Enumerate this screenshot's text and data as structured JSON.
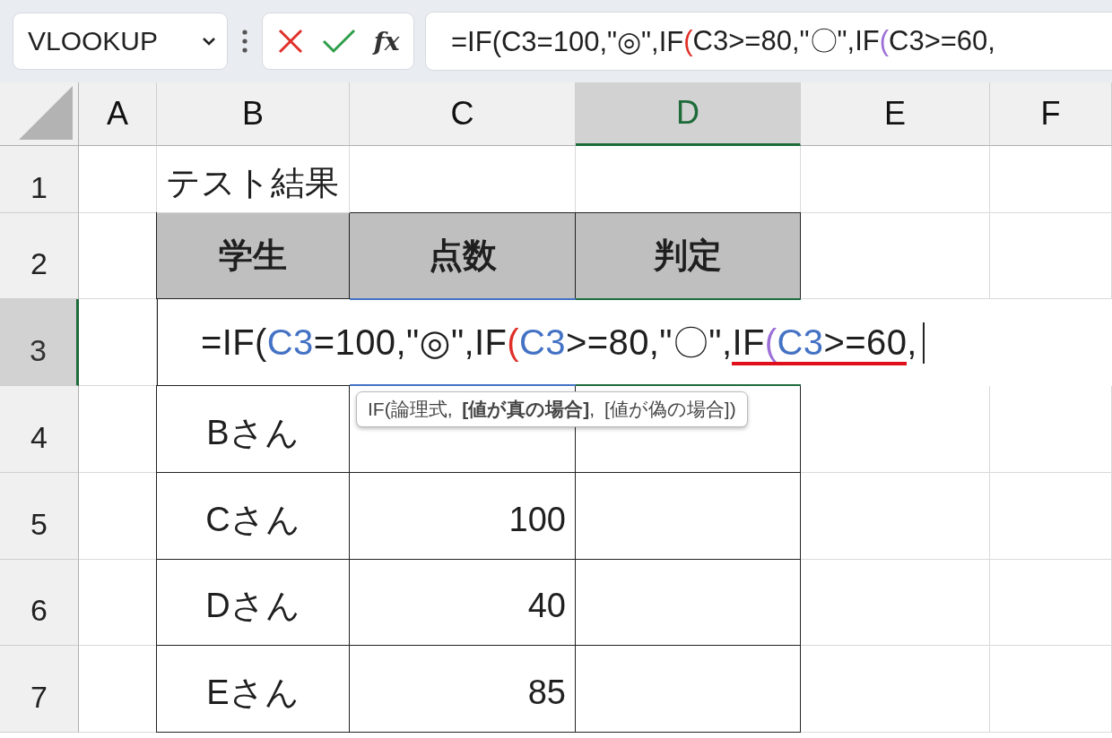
{
  "name_box": {
    "value": "VLOOKUP"
  },
  "function_button": {
    "label": "fx"
  },
  "formula_bar": {
    "segments": [
      {
        "text": "=IF(C3=100,\"◎\",IF",
        "color": "#1f1f1f"
      },
      {
        "text": "(",
        "color": "#e0302a"
      },
      {
        "text": "C3>=80,\"〇\",IF",
        "color": "#1f1f1f"
      },
      {
        "text": "(",
        "color": "#9b6fd6"
      },
      {
        "text": "C3>=60,",
        "color": "#1f1f1f"
      }
    ]
  },
  "columns": [
    {
      "label": "A",
      "selected": false
    },
    {
      "label": "B",
      "selected": false
    },
    {
      "label": "C",
      "selected": false
    },
    {
      "label": "D",
      "selected": true
    },
    {
      "label": "E",
      "selected": false
    },
    {
      "label": "F",
      "selected": false
    }
  ],
  "row_headers": [
    {
      "label": "1",
      "selected": false
    },
    {
      "label": "2",
      "selected": false
    },
    {
      "label": "3",
      "selected": true
    },
    {
      "label": "4",
      "selected": false
    },
    {
      "label": "5",
      "selected": false
    },
    {
      "label": "6",
      "selected": false
    },
    {
      "label": "7",
      "selected": false
    }
  ],
  "title": "テスト結果",
  "table": {
    "columns": [
      "学生",
      "点数",
      "判定"
    ],
    "rows": [
      {
        "student": "Bさん"
      },
      {
        "student": "Cさん",
        "score": "100"
      },
      {
        "student": "Dさん",
        "score": "40"
      },
      {
        "student": "Eさん",
        "score": "85"
      }
    ]
  },
  "editing_cell": {
    "segments": [
      {
        "text": "=IF(",
        "color": "#1f1f1f",
        "underlined": false
      },
      {
        "text": "C3",
        "color": "#4472c4",
        "underlined": false
      },
      {
        "text": "=100,\"◎\",IF",
        "color": "#1f1f1f",
        "underlined": false
      },
      {
        "text": "(",
        "color": "#e0302a",
        "underlined": false
      },
      {
        "text": "C3",
        "color": "#4472c4",
        "underlined": false
      },
      {
        "text": ">=80,\"〇\",",
        "color": "#1f1f1f",
        "underlined": false
      },
      {
        "text": "IF",
        "color": "#1f1f1f",
        "underlined": true
      },
      {
        "text": "(",
        "color": "#9b6fd6",
        "underlined": true
      },
      {
        "text": "C3",
        "color": "#4472c4",
        "underlined": true
      },
      {
        "text": ">=60",
        "color": "#1f1f1f",
        "underlined": true
      },
      {
        "text": ",",
        "color": "#1f1f1f",
        "underlined": false
      }
    ]
  },
  "tooltip": {
    "text": "IF(論理式, **[値が真の場合]**, [値が偽の場合])"
  }
}
